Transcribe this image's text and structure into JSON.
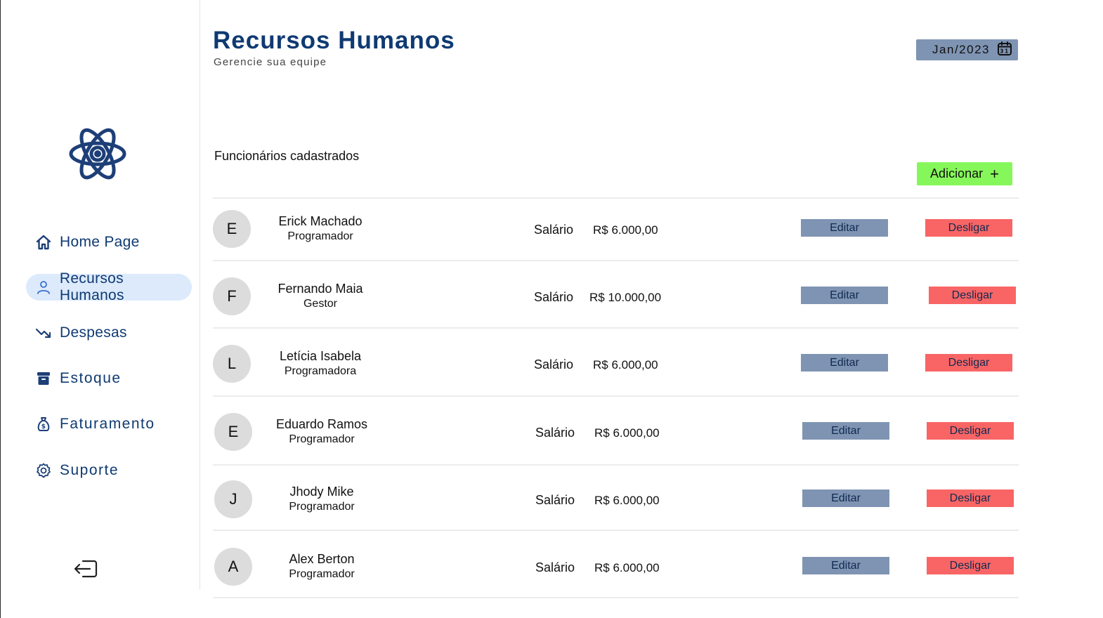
{
  "sidebar": {
    "items": [
      {
        "label": "Home Page",
        "icon": "home-icon",
        "active": false
      },
      {
        "label": "Recursos Humanos",
        "icon": "user-icon",
        "active": true
      },
      {
        "label": "Despesas",
        "icon": "trending-down-icon",
        "active": false
      },
      {
        "label": "Estoque",
        "icon": "archive-icon",
        "active": false
      },
      {
        "label": "Faturamento",
        "icon": "money-bag-icon",
        "active": false
      },
      {
        "label": "Suporte",
        "icon": "gear-icon",
        "active": false
      }
    ],
    "logo_icon": "atom-icon",
    "logout_icon": "logout-icon"
  },
  "header": {
    "title": "Recursos Humanos",
    "subtitle": "Gerencie sua equipe",
    "date": "Jan/2023",
    "date_icon": "calendar-icon",
    "date_icon_text": "31"
  },
  "section": {
    "title": "Funcionários cadastrados",
    "add_label": "Adicionar",
    "add_icon": "+"
  },
  "employees": [
    {
      "initial": "E",
      "name": "Erick Machado",
      "role": "Programador",
      "salary_label": "Salário",
      "salary": "R$ 6.000,00",
      "edit_label": "Editar",
      "fire_label": "Desligar"
    },
    {
      "initial": "F",
      "name": "Fernando Maia",
      "role": "Gestor",
      "salary_label": "Salário",
      "salary": "R$ 10.000,00",
      "edit_label": "Editar",
      "fire_label": "Desligar"
    },
    {
      "initial": "L",
      "name": "Letícia Isabela",
      "role": "Programadora",
      "salary_label": "Salário",
      "salary": "R$ 6.000,00",
      "edit_label": "Editar",
      "fire_label": "Desligar"
    },
    {
      "initial": "E",
      "name": "Eduardo Ramos",
      "role": "Programador",
      "salary_label": "Salário",
      "salary": "R$ 6.000,00",
      "edit_label": "Editar",
      "fire_label": "Desligar"
    },
    {
      "initial": "J",
      "name": "Jhody Mike",
      "role": "Programador",
      "salary_label": "Salário",
      "salary": "R$ 6.000,00",
      "edit_label": "Editar",
      "fire_label": "Desligar"
    },
    {
      "initial": "A",
      "name": "Alex Berton",
      "role": "Programador",
      "salary_label": "Salário",
      "salary": "R$ 6.000,00",
      "edit_label": "Editar",
      "fire_label": "Desligar"
    }
  ],
  "colors": {
    "primary": "#0f3a72",
    "active_bg": "#dceafc",
    "edit_button": "#7f94b3",
    "fire_button": "#f96565",
    "add_button": "#86f75a",
    "avatar_bg": "#dcdcdc"
  }
}
